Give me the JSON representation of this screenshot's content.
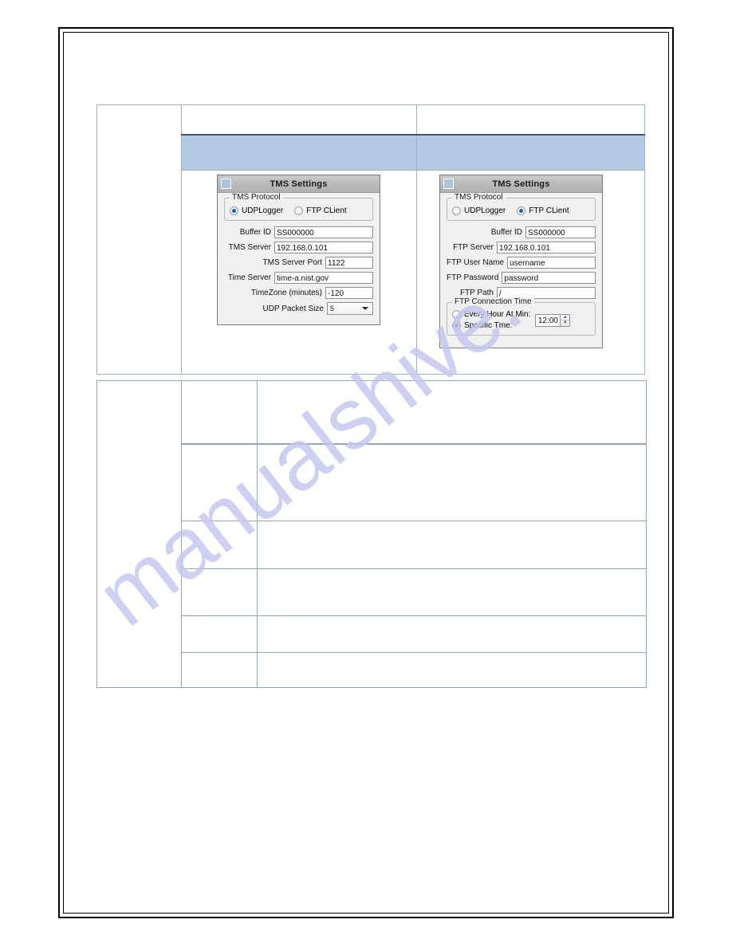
{
  "document": {
    "watermark": "manualshive."
  },
  "tables": {
    "top": {
      "rows": [
        {
          "type": "blank",
          "cells": [
            "",
            "",
            ""
          ]
        },
        {
          "type": "header-blue",
          "cells": [
            "",
            "",
            ""
          ]
        },
        {
          "type": "screenshots",
          "cells": [
            "",
            "",
            ""
          ]
        }
      ]
    },
    "bottom": {
      "rows": [
        {
          "cells": [
            "",
            "",
            ""
          ]
        },
        {
          "cells": [
            "",
            "",
            ""
          ]
        },
        {
          "cells": [
            "",
            "",
            ""
          ]
        },
        {
          "cells": [
            "",
            "",
            ""
          ]
        },
        {
          "cells": [
            "",
            "",
            ""
          ]
        },
        {
          "cells": [
            "",
            "",
            ""
          ]
        }
      ]
    }
  },
  "dialog_udp": {
    "title": "TMS Settings",
    "icon": "app-square-icon",
    "protocol_group": {
      "legend": "TMS Protocol",
      "options": [
        {
          "label": "UDPLogger",
          "selected": true
        },
        {
          "label": "FTP CLient",
          "selected": false
        }
      ]
    },
    "fields": [
      {
        "label": "Buffer ID",
        "value": "SS000000"
      },
      {
        "label": "TMS Server",
        "value": "192.168.0.101"
      },
      {
        "label": "TMS Server Port",
        "value": "1122"
      },
      {
        "label": "Time Server",
        "value": "time-a.nist.gov"
      },
      {
        "label": "TimeZone (minutes)",
        "value": "-120"
      }
    ],
    "combo": {
      "label": "UDP Packet Size",
      "value": "5"
    }
  },
  "dialog_ftp": {
    "title": "TMS Settings",
    "icon": "app-square-icon",
    "protocol_group": {
      "legend": "TMS Protocol",
      "options": [
        {
          "label": "UDPLogger",
          "selected": false
        },
        {
          "label": "FTP CLient",
          "selected": true
        }
      ]
    },
    "fields": [
      {
        "label": "Buffer ID",
        "value": "SS000000"
      },
      {
        "label": "FTP Server",
        "value": "192.168.0.101"
      },
      {
        "label": "FTP User Name",
        "value": "username"
      },
      {
        "label": "FTP Password",
        "value": "password"
      },
      {
        "label": "FTP Path",
        "value": "/"
      }
    ],
    "connection_group": {
      "legend": "FTP Connection Time",
      "options": [
        {
          "label": "Every Hour At Min:",
          "selected": false
        },
        {
          "label": "Specific Tme:",
          "selected": true
        }
      ],
      "spinner": {
        "value": "12:00",
        "up": "▲",
        "down": "▼"
      }
    }
  },
  "colors": {
    "header_blue": "#b4c9e3",
    "table_border": "#9fb0c0",
    "accent_border": "#44546a",
    "radio_dot": "#1e5fa8",
    "watermark": "#c3c6ee"
  }
}
